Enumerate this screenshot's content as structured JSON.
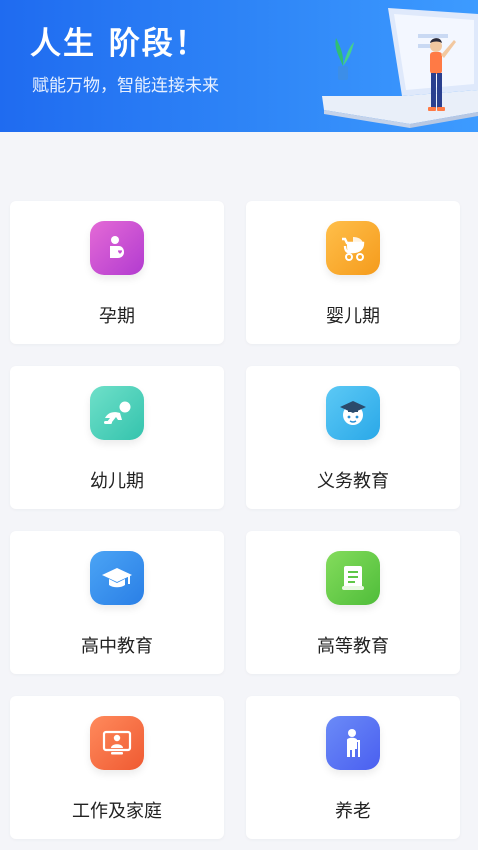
{
  "banner": {
    "title": "人生 阶段！",
    "subtitle": "赋能万物，智能连接未来"
  },
  "stages": [
    {
      "label": "孕期",
      "icon": "pregnancy-icon",
      "color_from": "#e46ad6",
      "color_to": "#b23bd0"
    },
    {
      "label": "婴儿期",
      "icon": "baby-stroller-icon",
      "color_from": "#ffbf4a",
      "color_to": "#f59b1c"
    },
    {
      "label": "幼儿期",
      "icon": "crawling-baby-icon",
      "color_from": "#6fe0c9",
      "color_to": "#34c3ad"
    },
    {
      "label": "义务教育",
      "icon": "student-cap-icon",
      "color_from": "#5cc9f5",
      "color_to": "#2aa8e8"
    },
    {
      "label": "高中教育",
      "icon": "graduation-cap-icon",
      "color_from": "#4ba4f5",
      "color_to": "#2a7fe6"
    },
    {
      "label": "高等教育",
      "icon": "diploma-icon",
      "color_from": "#84dc5c",
      "color_to": "#4fbd3a"
    },
    {
      "label": "工作及家庭",
      "icon": "work-person-icon",
      "color_from": "#ff8a5c",
      "color_to": "#ef5a32"
    },
    {
      "label": "养老",
      "icon": "elderly-person-icon",
      "color_from": "#6b8bf7",
      "color_to": "#4a5ff0"
    }
  ],
  "colors": {
    "banner_start": "#1f6bf0",
    "banner_end": "#3d9bff",
    "page_background": "#f4f5f9"
  }
}
